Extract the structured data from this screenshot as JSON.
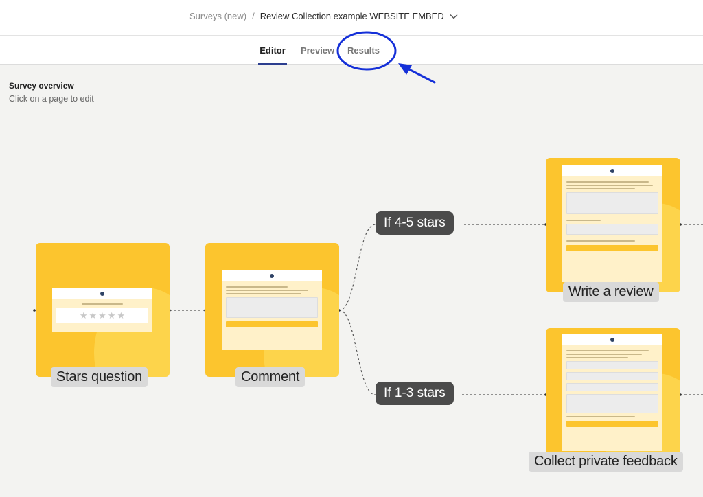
{
  "header": {
    "breadcrumb_parent": "Surveys (new)",
    "breadcrumb_separator": "/",
    "breadcrumb_current": "Review Collection example WEBSITE EMBED"
  },
  "tabs": {
    "editor": "Editor",
    "preview": "Preview",
    "results": "Results",
    "active": "Editor"
  },
  "overview": {
    "title": "Survey overview",
    "subtitle": "Click on a page to edit"
  },
  "nodes": {
    "stars": {
      "label": "Stars question"
    },
    "comment": {
      "label": "Comment"
    },
    "review": {
      "label": "Write a review"
    },
    "private": {
      "label": "Collect private feedback"
    }
  },
  "conditions": {
    "high": "If 4-5 stars",
    "low": "If 1-3 stars"
  },
  "colors": {
    "node_fill": "#fcc52e",
    "condition_fill": "#4b4b4b",
    "annotation": "#1530d8",
    "active_tab_underline": "#2c3e8f"
  },
  "annotation": {
    "target": "Results tab",
    "shapes": [
      "circle",
      "arrow"
    ]
  }
}
